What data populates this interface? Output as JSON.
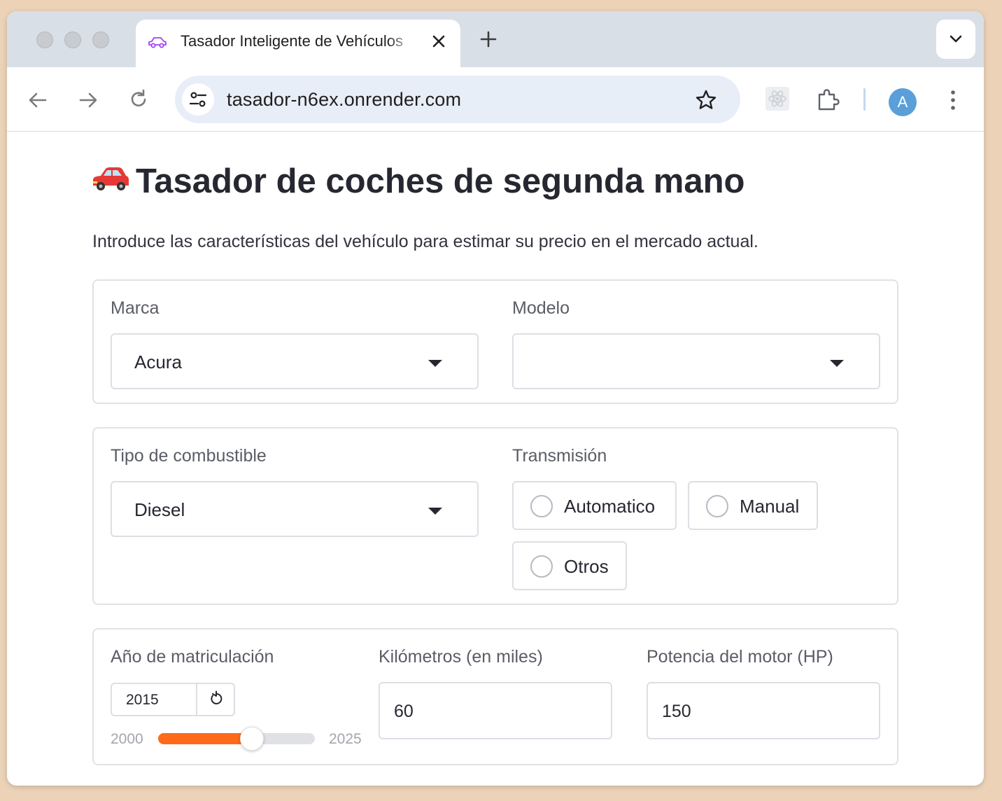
{
  "browser": {
    "tab_title": "Tasador Inteligente de Vehículos",
    "url": "tasador-n6ex.onrender.com",
    "avatar_letter": "A",
    "icons": [
      "car-icon",
      "close-icon",
      "plus-icon",
      "chevron-down-icon",
      "back-arrow-icon",
      "forward-arrow-icon",
      "reload-icon",
      "site-settings-icon",
      "star-icon",
      "react-devtools-icon",
      "extensions-icon",
      "more-vert-icon"
    ]
  },
  "page": {
    "title_emoji": "🚗",
    "title": "Tasador de coches de segunda mano",
    "intro": "Introduce las características del vehículo para estimar su precio en el mercado actual."
  },
  "form": {
    "marca": {
      "label": "Marca",
      "value": "Acura"
    },
    "modelo": {
      "label": "Modelo",
      "value": ""
    },
    "combustible": {
      "label": "Tipo de combustible",
      "value": "Diesel"
    },
    "transmision": {
      "label": "Transmisión",
      "options": [
        "Automatico",
        "Manual",
        "Otros"
      ],
      "selected": null
    },
    "anio": {
      "label": "Año de matriculación",
      "value": "2015",
      "min": "2000",
      "max": "2025",
      "fraction": 0.6
    },
    "kilometros": {
      "label": "Kilómetros (en miles)",
      "value": "60"
    },
    "potencia": {
      "label": "Potencia del motor (HP)",
      "value": "150"
    }
  },
  "colors": {
    "accent": "#ff6a1a",
    "avatar": "#5a9fd9"
  }
}
